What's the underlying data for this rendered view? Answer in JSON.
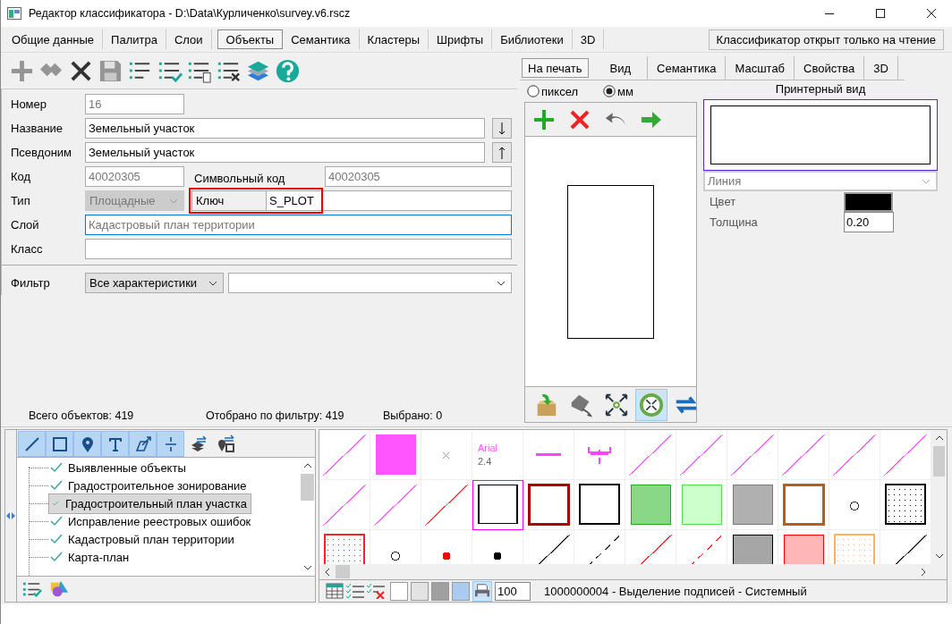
{
  "window": {
    "title": "Редактор классификатора - D:\\Data\\Курличенко\\survey.v6.rscz"
  },
  "tabs": [
    {
      "label": "Общие данные",
      "selected": false
    },
    {
      "label": "Палитра",
      "selected": false
    },
    {
      "label": "Слои",
      "selected": false
    },
    {
      "label": "Объекты",
      "selected": true
    },
    {
      "label": "Семантика",
      "selected": false
    },
    {
      "label": "Кластеры",
      "selected": false
    },
    {
      "label": "Шрифты",
      "selected": false
    },
    {
      "label": "Библиотеки",
      "selected": false
    },
    {
      "label": "3D",
      "selected": false
    }
  ],
  "readonly_notice": "Классификатор открыт только на чтение",
  "toolbar": [
    {
      "kind": "add",
      "disabled": true
    },
    {
      "kind": "copy",
      "disabled": true
    },
    {
      "kind": "delete",
      "disabled": false
    },
    {
      "kind": "save",
      "disabled": true
    },
    {
      "kind": "list",
      "disabled": false
    },
    {
      "kind": "list-check",
      "disabled": false
    },
    {
      "kind": "list-copy",
      "disabled": false
    },
    {
      "kind": "list-delete",
      "disabled": false
    },
    {
      "kind": "layers",
      "disabled": false
    },
    {
      "kind": "help",
      "disabled": false
    }
  ],
  "form": {
    "number": {
      "label": "Номер",
      "value": "16",
      "disabled": true
    },
    "name": {
      "label": "Название",
      "value": "Земельный участок",
      "disabled": false
    },
    "alias": {
      "label": "Псевдоним",
      "value": "Земельный участок",
      "disabled": false
    },
    "code": {
      "label": "Код",
      "value": "40020305",
      "disabled": true
    },
    "symbol_code": {
      "label": "Символьный код",
      "value": "40020305",
      "disabled": true
    },
    "type": {
      "label": "Тип",
      "value": "Площадные",
      "disabled": true
    },
    "key": {
      "label": "Ключ",
      "value": "S_PLOT",
      "highlighted": true
    },
    "layer": {
      "label": "Слой",
      "placeholder": "Кадастровый план территории",
      "focused": true
    },
    "class": {
      "label": "Класс"
    },
    "filter": {
      "label": "Фильтр",
      "value": "Все характеристики"
    }
  },
  "counts": {
    "total": "Всего объектов: 419",
    "filtered": "Отобрано по фильтру: 419",
    "selected": "Выбрано: 0"
  },
  "view": {
    "tabs": [
      {
        "label": "На печать",
        "selected": true
      },
      {
        "label": "Вид",
        "selected": false
      },
      {
        "label": "Семантика",
        "selected": false
      },
      {
        "label": "Масштаб",
        "selected": false
      },
      {
        "label": "Свойства",
        "selected": false
      },
      {
        "label": "3D",
        "selected": false
      }
    ],
    "units": [
      {
        "label": "пиксел",
        "selected": false
      },
      {
        "label": "мм",
        "selected": true
      }
    ],
    "preview_title": "Принтерный вид",
    "element_type": {
      "value": "Линия",
      "disabled": true
    },
    "color": {
      "label": "Цвет",
      "color": "#000000"
    },
    "thickness": {
      "label": "Толщина",
      "value": "0.20"
    },
    "tools": [
      {
        "kind": "import",
        "selected": false
      },
      {
        "kind": "export",
        "selected": false
      },
      {
        "kind": "fit",
        "selected": false
      },
      {
        "kind": "shrink",
        "selected": true
      },
      {
        "kind": "swap",
        "selected": false
      }
    ]
  },
  "tree_toolbar": [
    {
      "kind": "line",
      "on": true
    },
    {
      "kind": "square",
      "on": true
    },
    {
      "kind": "pin",
      "on": true
    },
    {
      "kind": "text",
      "on": true
    },
    {
      "kind": "vector",
      "on": true
    },
    {
      "kind": "fraction",
      "on": true
    },
    {
      "kind": "layers-swap",
      "on": false
    },
    {
      "kind": "pin-swap",
      "on": false
    }
  ],
  "tree": [
    {
      "label": "Выявленные объекты",
      "checked": true,
      "selected": false
    },
    {
      "label": "Градостроительное зонирование",
      "checked": true,
      "selected": false
    },
    {
      "label": "Градостроительный план участка",
      "checked": true,
      "selected": true
    },
    {
      "label": "Исправление реестровых ошибок",
      "checked": true,
      "selected": false
    },
    {
      "label": "Кадастровый план территории",
      "checked": true,
      "selected": false
    },
    {
      "label": "Карта-план",
      "checked": true,
      "selected": false
    }
  ],
  "symbols": [
    {
      "kind": "line",
      "color": "#ff66ff",
      "selected": false
    },
    {
      "kind": "fill",
      "color": "#ff55ff",
      "selected": false
    },
    {
      "kind": "cross",
      "color": "#ff66ff",
      "selected": false
    },
    {
      "kind": "font",
      "font": "Arial",
      "size": "2.4",
      "color": "#ff55ff",
      "selected": false
    },
    {
      "kind": "dash",
      "color": "#ff44ff",
      "selected": false
    },
    {
      "kind": "scale",
      "color": "#ff44ff",
      "selected": false
    },
    {
      "kind": "line",
      "color": "#ff66ff",
      "selected": false
    },
    {
      "kind": "line",
      "color": "#ff66ff",
      "selected": false
    },
    {
      "kind": "line",
      "color": "#ff66ff",
      "selected": false
    },
    {
      "kind": "line",
      "color": "#ff66ff",
      "selected": false
    },
    {
      "kind": "line",
      "color": "#ff66ff",
      "selected": false
    },
    {
      "kind": "line",
      "color": "#ff66ff",
      "selected": false
    },
    {
      "kind": "line",
      "color": "#ff66ff",
      "selected": false
    },
    {
      "kind": "line",
      "color": "#ff66ff",
      "selected": false
    },
    {
      "kind": "line",
      "color": "#ff4444",
      "selected": false
    },
    {
      "kind": "square",
      "color": "#000000",
      "selected": true
    },
    {
      "kind": "frame",
      "color": "#aa0000",
      "selected": false
    },
    {
      "kind": "square",
      "color": "#000000",
      "selected": false
    },
    {
      "kind": "fill",
      "color": "#88d888",
      "selected": false
    },
    {
      "kind": "fill",
      "color": "#ccffcc",
      "selected": false
    },
    {
      "kind": "fill",
      "color": "#b0b0b0",
      "selected": false
    },
    {
      "kind": "frame",
      "color": "#b06020",
      "selected": false
    },
    {
      "kind": "circle",
      "color": "#333333",
      "selected": false
    },
    {
      "kind": "dotted",
      "color": "#000000",
      "selected": false
    },
    {
      "kind": "dotted",
      "color": "#ff2222",
      "selected": false
    },
    {
      "kind": "circle",
      "color": "#222222",
      "selected": false
    },
    {
      "kind": "dot",
      "color": "#ff0000",
      "selected": false
    },
    {
      "kind": "dot",
      "color": "#000000",
      "selected": false
    },
    {
      "kind": "line",
      "color": "#333333",
      "selected": false
    },
    {
      "kind": "dashed",
      "color": "#333333",
      "selected": false
    },
    {
      "kind": "line",
      "color": "#ff3333",
      "selected": false
    },
    {
      "kind": "dashed",
      "color": "#ff3333",
      "selected": false
    },
    {
      "kind": "fill",
      "color": "#a6a6a6",
      "selected": false
    },
    {
      "kind": "fill",
      "color": "#ffb6b6",
      "selected": false
    },
    {
      "kind": "dotted",
      "color": "#ffb060",
      "selected": false
    },
    {
      "kind": "line",
      "color": "#333333",
      "selected": false
    }
  ],
  "swatches": [
    {
      "color": "#ffffff"
    },
    {
      "color": "#e3e3e3"
    },
    {
      "color": "#a0a0a0"
    },
    {
      "color": "#a9cbef"
    }
  ],
  "zoom": "100",
  "status_text": "1000000004 - Выделение подписей - Системный"
}
